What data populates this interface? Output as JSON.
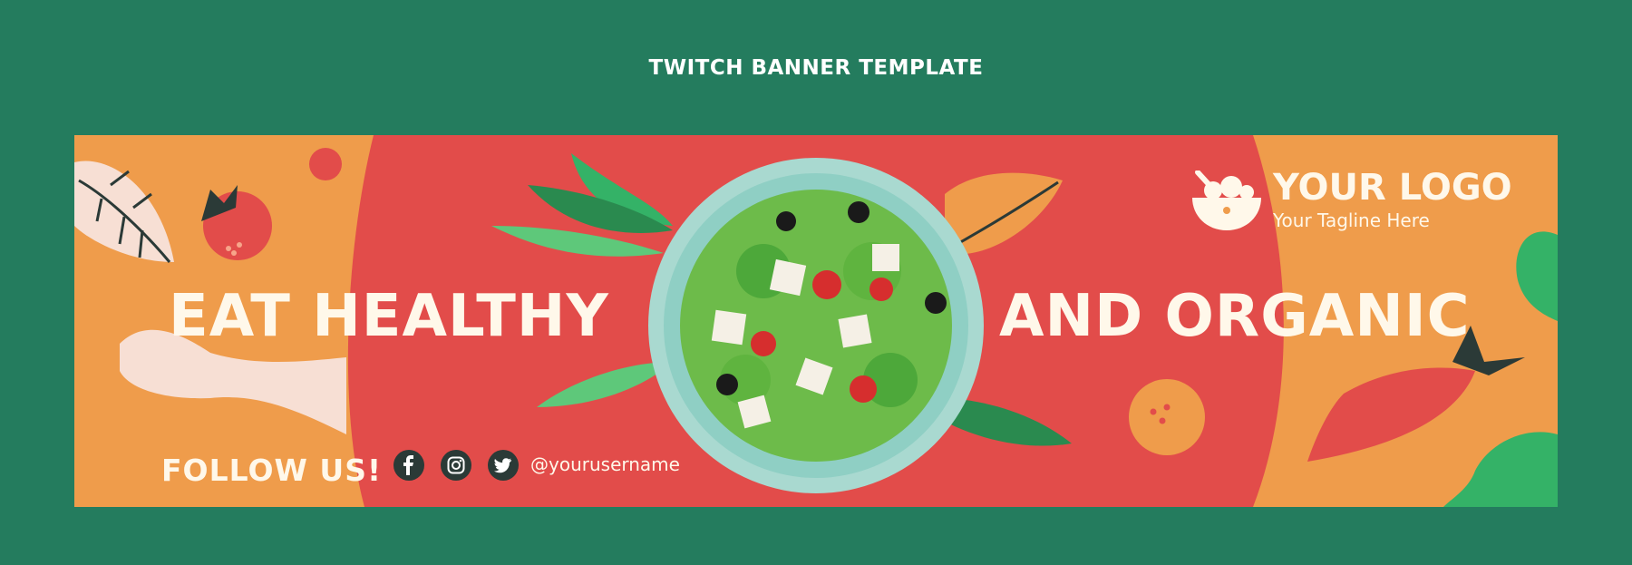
{
  "page_title": "TWITCH BANNER TEMPLATE",
  "banner": {
    "headline_left": "EAT HEALTHY",
    "headline_right": "AND ORGANIC",
    "follow_label": "FOLLOW US!",
    "username": "@yourusername",
    "social_icons": [
      "facebook-icon",
      "instagram-icon",
      "twitter-icon"
    ],
    "logo": {
      "text": "YOUR LOGO",
      "tagline": "Your Tagline Here",
      "icon": "salad-bowl-icon"
    },
    "colors": {
      "outer_background": "#247c5e",
      "banner_orange": "#ef9c4b",
      "banner_red": "#e24c4a",
      "accent_green": "#34b267",
      "text_cream": "#fff8ea"
    }
  }
}
